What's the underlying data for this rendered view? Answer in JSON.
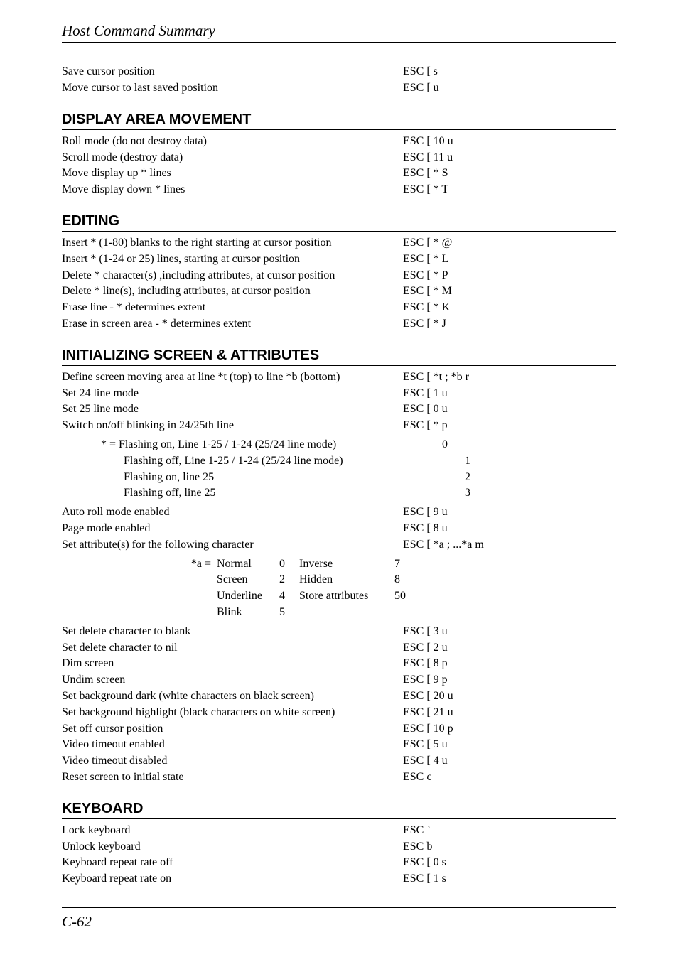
{
  "header": "Host Command Summary",
  "pre_rows": [
    {
      "desc": "Save cursor position",
      "code": "ESC [ s"
    },
    {
      "desc": "Move cursor to last saved position",
      "code": "ESC [ u"
    }
  ],
  "sections": [
    {
      "title": "DISPLAY AREA MOVEMENT",
      "rows": [
        {
          "desc": "Roll mode (do not destroy data)",
          "code": "ESC [ 10 u"
        },
        {
          "desc": "Scroll mode (destroy data)",
          "code": "ESC [ 11 u"
        },
        {
          "desc": "Move display up * lines",
          "code": "ESC [ * S"
        },
        {
          "desc": "Move display down * lines",
          "code": "ESC [ * T"
        }
      ]
    },
    {
      "title": "EDITING",
      "rows": [
        {
          "desc": "Insert * (1-80) blanks to the right starting at cursor position",
          "code": "ESC [ * @"
        },
        {
          "desc": "Insert * (1-24 or 25) lines, starting at cursor position",
          "code": "ESC [ * L"
        },
        {
          "desc": "Delete * character(s) ,including attributes, at cursor position",
          "code": "ESC [ * P"
        },
        {
          "desc": "Delete * line(s), including attributes, at cursor position",
          "code": "ESC [ * M"
        },
        {
          "desc": "Erase line - * determines extent",
          "code": "ESC [ * K"
        },
        {
          "desc": "Erase in screen area - * determines extent",
          "code": "ESC [ * J"
        }
      ]
    },
    {
      "title": "INITIALIZING SCREEN & ATTRIBUTES",
      "rows_a": [
        {
          "desc": "Define screen moving area at line *t (top) to line *b (bottom)",
          "code": "ESC [ *t ; *b r"
        },
        {
          "desc": "Set 24 line mode",
          "code": "ESC [ 1 u"
        },
        {
          "desc": "Set 25 line mode",
          "code": "ESC [ 0 u"
        },
        {
          "desc": "Switch on/off blinking in 24/25th line",
          "code": "ESC [ * p"
        }
      ],
      "indent_rows": [
        {
          "desc": "* =  Flashing on, Line 1-25 / 1-24 (25/24 line mode)",
          "code": "0"
        },
        {
          "desc": "Flashing off, Line 1-25 / 1-24 (25/24 line mode)",
          "code": "1",
          "extra_indent": true
        },
        {
          "desc": "Flashing on, line 25",
          "code": "2",
          "extra_indent": true
        },
        {
          "desc": "Flashing off, line 25",
          "code": "3",
          "extra_indent": true
        }
      ],
      "rows_b": [
        {
          "desc": "Auto roll mode enabled",
          "code": "ESC [ 9 u"
        },
        {
          "desc": "Page mode enabled",
          "code": "ESC [ 8 u"
        },
        {
          "desc": "Set attribute(s) for the following character",
          "code": "ESC [ *a ; ...*a m"
        }
      ],
      "legend": [
        {
          "c1": "*a =",
          "c2": "Normal",
          "c3": "0",
          "c4": "Inverse",
          "c5": "7"
        },
        {
          "c1": "",
          "c2": "Screen",
          "c3": "2",
          "c4": "Hidden",
          "c5": "8"
        },
        {
          "c1": "",
          "c2": "Underline",
          "c3": "4",
          "c4": "Store attributes",
          "c5": "50"
        },
        {
          "c1": "",
          "c2": "Blink",
          "c3": "5",
          "c4": "",
          "c5": ""
        }
      ],
      "rows_c": [
        {
          "desc": "Set delete character to blank",
          "code": "ESC [ 3 u"
        },
        {
          "desc": "Set delete character to nil",
          "code": "ESC [ 2 u"
        },
        {
          "desc": "Dim screen",
          "code": "ESC [ 8 p"
        },
        {
          "desc": "Undim screen",
          "code": "ESC [ 9 p"
        },
        {
          "desc": "Set background dark (white characters on black screen)",
          "code": "ESC [ 20 u"
        },
        {
          "desc": "Set background highlight (black characters on white screen)",
          "code": "ESC [ 21 u"
        },
        {
          "desc": "Set off cursor position",
          "code": "ESC [ 10 p"
        },
        {
          "desc": "Video timeout enabled",
          "code": "ESC [ 5 u"
        },
        {
          "desc": "Video timeout disabled",
          "code": "ESC [ 4 u"
        },
        {
          "desc": "Reset screen to initial state",
          "code": "ESC c"
        }
      ]
    },
    {
      "title": "KEYBOARD",
      "rows": [
        {
          "desc": "Lock keyboard",
          "code": "ESC `"
        },
        {
          "desc": "Unlock keyboard",
          "code": "ESC b"
        },
        {
          "desc": "Keyboard repeat rate off",
          "code": "ESC [ 0 s"
        },
        {
          "desc": "Keyboard repeat rate on",
          "code": "ESC [ 1 s"
        }
      ]
    }
  ],
  "footer": "C-62"
}
